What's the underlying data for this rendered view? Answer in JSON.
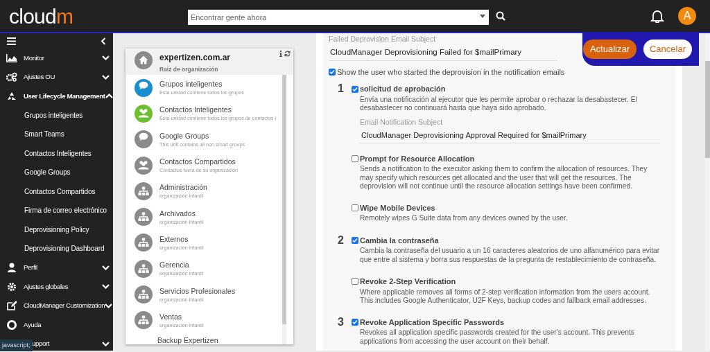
{
  "header": {
    "logo_main": "cloud",
    "logo_accent": "m",
    "search": {
      "placeholder": "Encontrar gente ahora"
    },
    "avatar": "A"
  },
  "sidebar": {
    "items": [
      {
        "label": "Monitor",
        "expanded": false
      },
      {
        "label": "Ajustes OU",
        "expanded": false
      },
      {
        "label": "User Lifecycle Management",
        "expanded": true,
        "children": [
          {
            "label": "Grupos inteligentes"
          },
          {
            "label": "Smart Teams"
          },
          {
            "label": "Contactos Inteligentes"
          },
          {
            "label": "Google Groups"
          },
          {
            "label": "Contactos Compartidos"
          },
          {
            "label": "Firma de correo electrónico"
          },
          {
            "label": "Deprovisioning Policy"
          },
          {
            "label": "Deprovisioning Dashboard"
          }
        ]
      },
      {
        "label": "Perfil",
        "expanded": false
      },
      {
        "label": "Ajustes globales",
        "expanded": false
      },
      {
        "label": "CloudManager Customization",
        "expanded": false
      },
      {
        "label": "Ayuda"
      },
      {
        "label": "upport",
        "expanded": false
      }
    ]
  },
  "org_panel": {
    "root": {
      "title": "expertizen.com.ar",
      "subtitle": "Raíz de organización"
    },
    "units": [
      {
        "title": "Grupos inteligentes",
        "subtitle": "Esta unidad contiene todos los grupos",
        "kind": "chat",
        "color": "#1a8fd0"
      },
      {
        "title": "Contactos Inteligentes",
        "subtitle": "Este unidad contiene todos los grupos de contactos i",
        "kind": "people",
        "color": "#6cbf2f"
      },
      {
        "title": "Google Groups",
        "subtitle": "This unit contains all non smart groups",
        "kind": "chat",
        "color": "#8a8a8a"
      },
      {
        "title": "Contactos Compartidos",
        "subtitle": "Contactos fuera de su organización",
        "kind": "people",
        "color": "#8a8a8a"
      },
      {
        "title": "Administración",
        "subtitle": "organización infantil",
        "kind": "org",
        "color": "#8a8a8a"
      },
      {
        "title": "Archivados",
        "subtitle": "organización infantil",
        "kind": "org",
        "color": "#8a8a8a"
      },
      {
        "title": "Externos",
        "subtitle": "organización infantil",
        "kind": "org",
        "color": "#8a8a8a"
      },
      {
        "title": "Gerencia",
        "subtitle": "organización infantil",
        "kind": "org",
        "color": "#8a8a8a"
      },
      {
        "title": "Servicios Profesionales",
        "subtitle": "organización infantil",
        "kind": "org",
        "color": "#8a8a8a"
      },
      {
        "title": "Ventas",
        "subtitle": "organización infantil",
        "kind": "org",
        "color": "#8a8a8a"
      },
      {
        "title": "Backup Expertizen",
        "kind": "blank"
      }
    ]
  },
  "policy": {
    "failed_subject": {
      "label": "Failed Deprovision Email Subject",
      "value": "CloudManager Deprovisioning Failed for $mailPrimary"
    },
    "show_user": {
      "label": "Show the user who started the deprovision in the notification emails",
      "checked": true
    },
    "steps": [
      {
        "number": "1",
        "title": "solicitud de aprobación",
        "checked": true,
        "description": "Envía una notificación al ejecutor que les permite aprobar o rechazar la desabastecer. El desabastecer no continuará hasta que haya sido aprobado.",
        "subject_label": "Email Notification Subject",
        "subject_value": "CloudManager Deprovisioning Approval Required for $mailPrimary"
      },
      {
        "title": "Prompt for Resource Allocation",
        "checked": false,
        "description": "Sends a notification to the executor asking them to confirm the allocation of resources. They may specify which resources get allocated and the user that will get the resources. The deprovision will not continue until the resource allocation settings have been confirmed."
      },
      {
        "title": "Wipe Mobile Devices",
        "checked": false,
        "description": "Remotely wipes G Suite data from any devices owned by the user."
      },
      {
        "number": "2",
        "title": "Cambia la contraseña",
        "checked": true,
        "description": "Cambia la contraseña del usuario a un 16 caracteres aleatorios de uno alfanumérico para evitar que entre al sistema y borra sus respuestas de la pregunta de restablecimiento de contraseña."
      },
      {
        "title": "Revoke 2-Step Verification",
        "checked": false,
        "description": "Where applicable removes all forms of 2-step verification information from the users account. This includes Google Authenticator, U2F Keys, backup codes and fallback email addresses."
      },
      {
        "number": "3",
        "title": "Revoke Application Specific Passwords",
        "checked": true,
        "description": "Revokes all application specific passwords created for the user's account. This prevents applications from accessing the user account on their behalf."
      }
    ]
  },
  "actions": {
    "primary": "Actualizar",
    "secondary": "Cancelar"
  },
  "status_bar": "javascript;"
}
